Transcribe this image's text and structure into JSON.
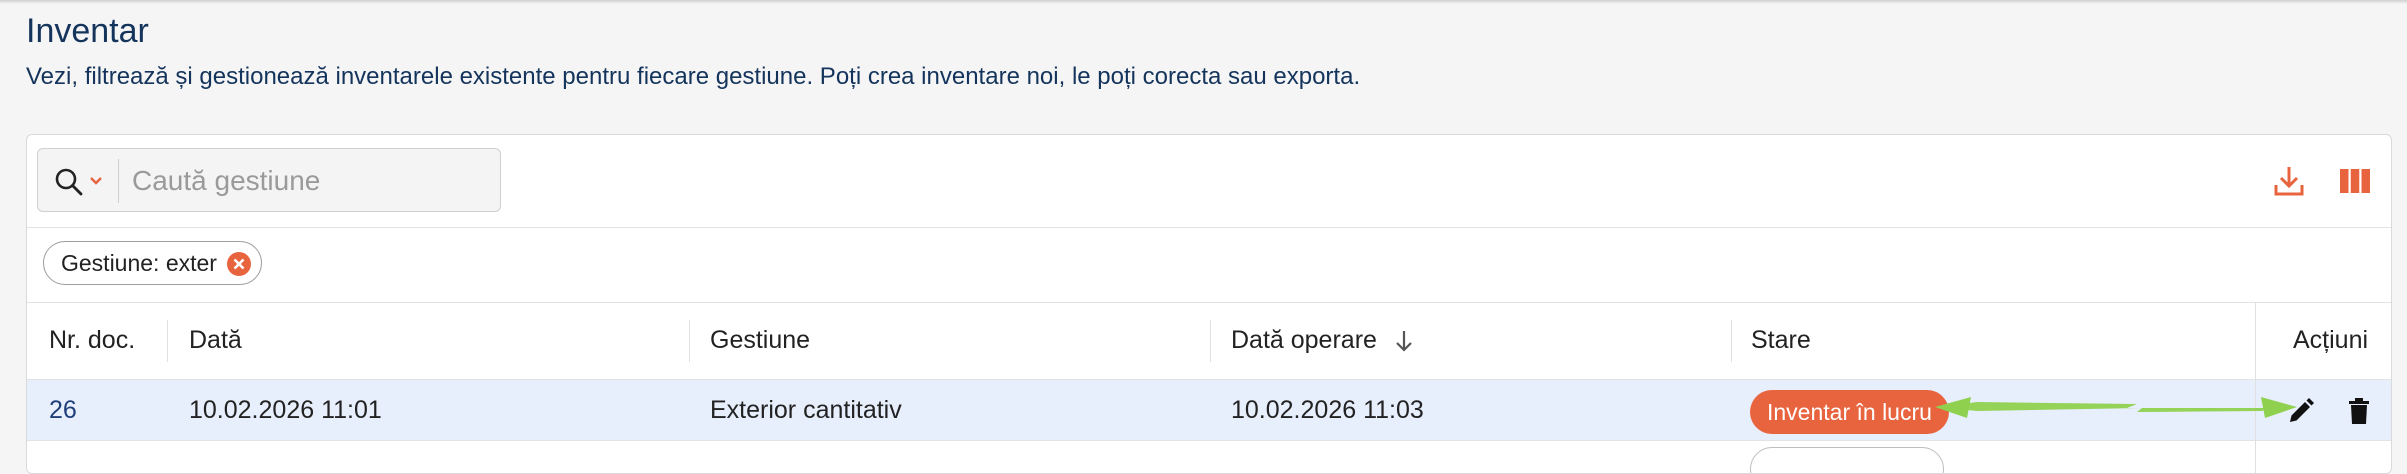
{
  "page": {
    "title": "Inventar",
    "description": "Vezi, filtrează și gestionează inventarele existente pentru fiecare gestiune. Poți crea inventare noi, le poți corecta sau exporta."
  },
  "toolbar": {
    "search_placeholder": "Caută gestiune",
    "search_value": "",
    "icons": [
      "search-icon",
      "chevron-down-icon",
      "download-icon",
      "columns-icon"
    ]
  },
  "filters": {
    "chips": [
      {
        "label": "Gestiune: exter",
        "remove_icon": "close-circle-icon"
      }
    ]
  },
  "table": {
    "columns": [
      {
        "label": "Nr. doc."
      },
      {
        "label": "Dată"
      },
      {
        "label": "Gestiune"
      },
      {
        "label": "Dată operare",
        "sort": "desc"
      },
      {
        "label": "Stare"
      },
      {
        "label": "Acțiuni"
      }
    ],
    "rows": [
      {
        "nr_doc": "26",
        "data": "10.02.2026 11:01",
        "gestiune": "Exterior cantitativ",
        "data_operare": "10.02.2026 11:03",
        "stare": "Inventar în lucru",
        "actions": [
          "edit-icon",
          "trash-icon"
        ]
      }
    ]
  },
  "colors": {
    "accent": "#e8643f",
    "title": "#14345c",
    "link": "#1f3f7a",
    "row_highlight": "#e8effc",
    "annotation_arrow": "#8fd14f"
  }
}
